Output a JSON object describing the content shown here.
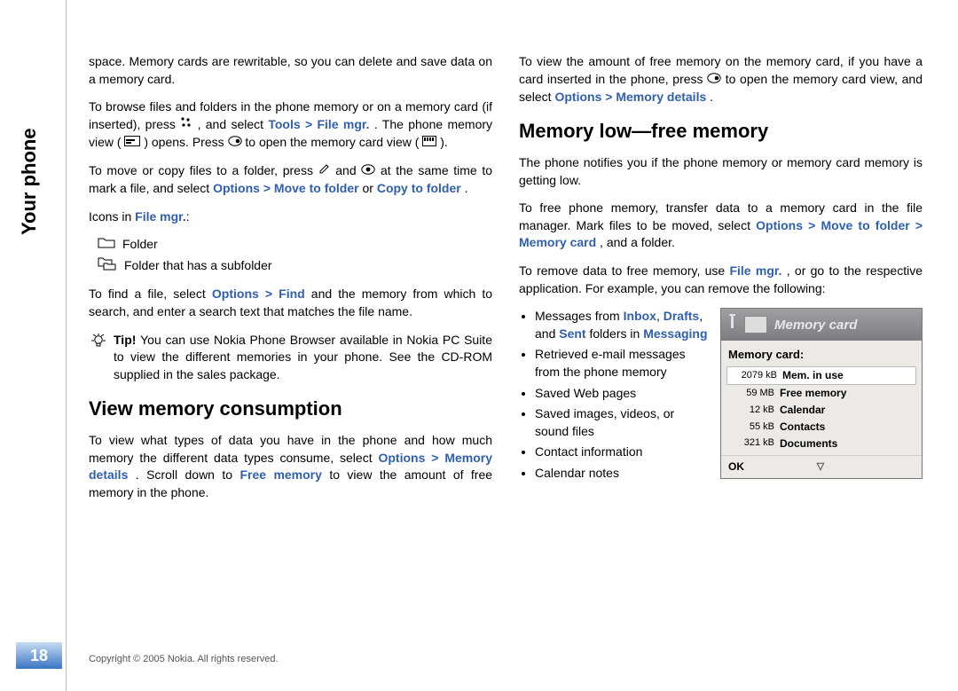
{
  "sidebar": {
    "tab_label": "Your phone"
  },
  "page_number": "18",
  "copyright": "Copyright © 2005 Nokia. All rights reserved.",
  "col1": {
    "p1_a": "space. Memory cards are rewritable, so you can delete and save data on a memory card.",
    "p2_a": "To browse files and folders in the phone memory or on a memory card (if inserted), press ",
    "p2_b": ", and select ",
    "p2_tools": "Tools",
    "p2_gt1": " > ",
    "p2_filemgr": "File mgr.",
    "p2_c": ". The phone memory view (",
    "p2_d": ") opens. Press ",
    "p2_e": "to open the memory card view (",
    "p2_f": ").",
    "p3_a": "To move or copy files to a folder, press ",
    "p3_b": " and ",
    "p3_c": " at the same time to mark a file, and select ",
    "p3_options": "Options",
    "p3_gt": " > ",
    "p3_move": "Move to folder",
    "p3_or": " or ",
    "p3_copy": "Copy to folder",
    "p3_end": ".",
    "icons_label_a": "Icons in ",
    "icons_label_b": "File mgr.",
    "icons_label_c": ":",
    "icon1": "Folder",
    "icon2": "Folder that has a subfolder",
    "p4_a": "To find a file, select ",
    "p4_options": "Options",
    "p4_gt": " > ",
    "p4_find": "Find",
    "p4_b": " and the memory from which to search, and enter a search text that matches the file name.",
    "tip_label": "Tip! ",
    "tip_text": "You can use Nokia Phone Browser available in Nokia PC Suite to view the different memories in your phone. See the CD-ROM supplied in the sales package.",
    "h_view": "View memory consumption",
    "p5_a": "To view what types of data you have in the phone and how much memory the different data types consume, select ",
    "p5_options": "Options",
    "p5_gt": " > ",
    "p5_memdet": "Memory details",
    "p5_b": ". Scroll down to ",
    "p5_freemem": "Free memory",
    "p5_c": " to view the amount of free memory in the phone."
  },
  "col2": {
    "p1_a": "To view the amount of free memory on the memory card, if you have a card inserted in the phone, press ",
    "p1_b": " to open the memory card view, and select ",
    "p1_options": "Options",
    "p1_gt": " > ",
    "p1_memdet": "Memory details",
    "p1_end": ".",
    "h_low": "Memory low—free memory",
    "p2": "The phone notifies you if the phone memory or memory card memory is getting low.",
    "p3_a": "To free phone memory, transfer data to a memory card in the file manager. Mark files to be moved, select ",
    "p3_options": "Options",
    "p3_gt1": " > ",
    "p3_move": "Move to folder",
    "p3_gt2": " > ",
    "p3_memcard": "Memory card",
    "p3_b": ", and a folder.",
    "p4_a": "To remove data to free memory, use ",
    "p4_filemgr": "File mgr.",
    "p4_b": ", or go to the respective application. For example, you can remove the following:",
    "bullets": {
      "b1_a": "Messages from ",
      "b1_inbox": "Inbox",
      "b1_c": ", ",
      "b1_drafts": "Drafts",
      "b1_d": ", and ",
      "b1_sent": "Sent",
      "b1_e": " folders in ",
      "b1_msg": "Messaging",
      "b2": "Retrieved e-mail messages from the phone memory",
      "b3": "Saved Web pages",
      "b4": "Saved images, videos, or sound files",
      "b5": "Contact information",
      "b6": "Calendar notes"
    }
  },
  "widget": {
    "header": "Memory card",
    "title": "Memory card:",
    "rows": [
      {
        "val": "2079 kB",
        "lbl": "Mem. in use"
      },
      {
        "val": "59 MB",
        "lbl": "Free memory"
      },
      {
        "val": "12 kB",
        "lbl": "Calendar"
      },
      {
        "val": "55 kB",
        "lbl": "Contacts"
      },
      {
        "val": "321 kB",
        "lbl": "Documents"
      }
    ],
    "footer_ok": "OK"
  }
}
